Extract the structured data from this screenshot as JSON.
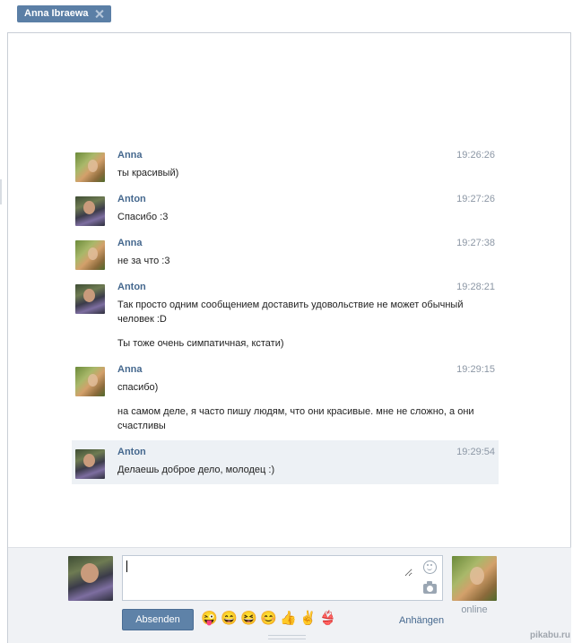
{
  "tab": {
    "name": "Anna Ibraewa"
  },
  "messages": [
    {
      "author": "Anna",
      "time": "19:26:26",
      "avatar": "anna-avatar",
      "texts": [
        "ты красивый)"
      ]
    },
    {
      "author": "Anton",
      "time": "19:27:26",
      "avatar": "anton-avatar",
      "texts": [
        "Спасибо :3"
      ]
    },
    {
      "author": "Anna",
      "time": "19:27:38",
      "avatar": "anna-avatar",
      "texts": [
        "не за что :3"
      ]
    },
    {
      "author": "Anton",
      "time": "19:28:21",
      "avatar": "anton-avatar",
      "texts": [
        "Так просто одним сообщением доставить удовольствие не может обычный человек :D",
        "Ты тоже очень симпатичная, кстати)"
      ]
    },
    {
      "author": "Anna",
      "time": "19:29:15",
      "avatar": "anna-avatar",
      "texts": [
        "спасибо)",
        "на самом деле, я часто пишу людям, что они красивые. мне не сложно, а они счастливы"
      ]
    },
    {
      "author": "Anton",
      "time": "19:29:54",
      "avatar": "anton-avatar",
      "texts": [
        "Делаешь доброе дело, молодец :)"
      ]
    }
  ],
  "composer": {
    "input_value": "",
    "send_label": "Absenden",
    "attach_label": "Anhängen",
    "peer_status": "online",
    "emojis": [
      "😜",
      "😄",
      "😆",
      "😊",
      "👍",
      "✌",
      "👙"
    ]
  },
  "watermark": "pikabu.ru"
}
